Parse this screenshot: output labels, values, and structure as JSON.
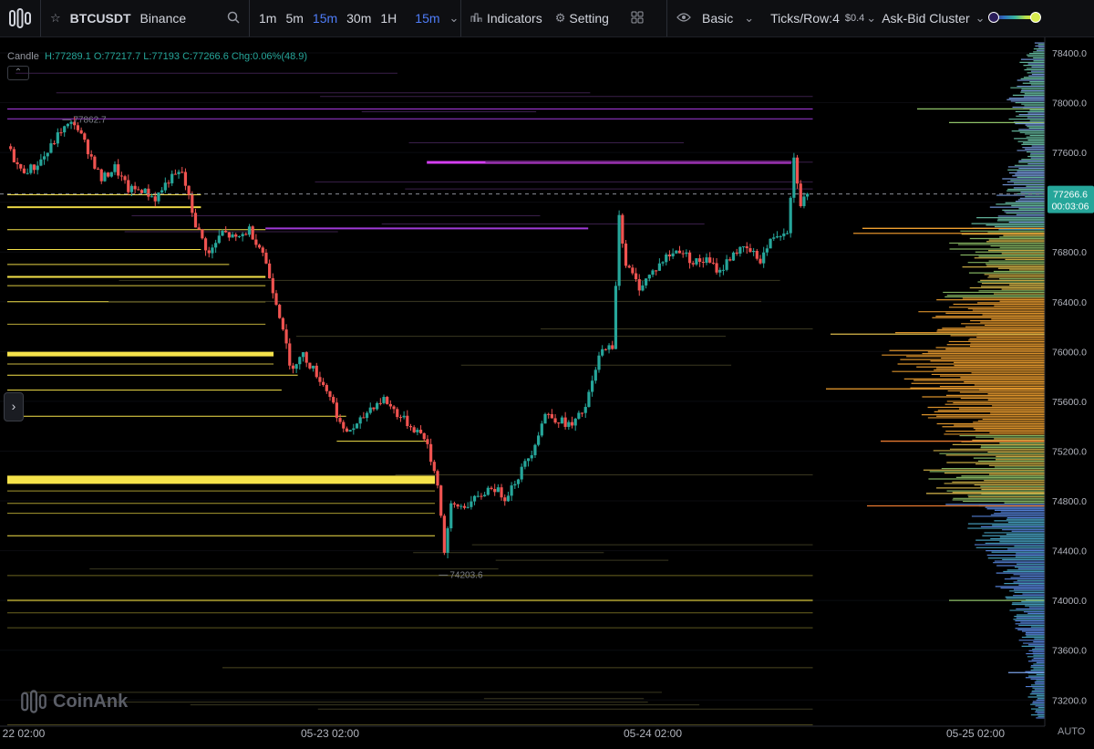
{
  "toolbar": {
    "symbol": "BTCUSDT",
    "exchange": "Binance",
    "timeframes": [
      "1m",
      "5m",
      "15m",
      "30m",
      "1H"
    ],
    "active_timeframe": "15m",
    "selected_timeframe": "15m",
    "indicators_label": "Indicators",
    "setting_label": "Setting",
    "mode_label": "Basic",
    "ticks_label": "Ticks/Row:4",
    "ticks_value": "$0.4",
    "cluster_label": "Ask-Bid Cluster"
  },
  "legend": {
    "type_label": "Candle",
    "high": "H:77289.1",
    "open": "O:77217.7",
    "low": "L:77193",
    "close": "C:77266.6",
    "change": "Chg:0.06%(48.9)",
    "collapse_glyph": "⌃"
  },
  "side_toggle": "›",
  "watermark": "CoinAnk",
  "auto_label": "AUTO",
  "colors": {
    "up": "#26a69a",
    "down": "#ef5350",
    "level_yellow": "#f5e24a",
    "level_purple": "#b43df0",
    "price_tag": "#26a69a"
  },
  "chart_data": {
    "type": "candlestick",
    "title": "",
    "price_axis": {
      "ylim": [
        73000,
        78500
      ],
      "ticks": [
        78400,
        78000,
        77600,
        77200,
        76800,
        76400,
        76000,
        75600,
        75200,
        74800,
        74400,
        74000,
        73600,
        73200
      ],
      "tick_labels": [
        "78400.0",
        "78000.0",
        "77600.0",
        "77200.0",
        "76800.0",
        "76400.0",
        "76000.0",
        "75600.0",
        "75200.0",
        "74800.0",
        "74400.0",
        "74000.0",
        "73600.0",
        "73200.0"
      ]
    },
    "time_axis": {
      "tick_labels": [
        "22 02:00",
        "05-23 02:00",
        "05-24 02:00",
        "05-25 02:00"
      ],
      "tick_hours": [
        0,
        24,
        48,
        72
      ]
    },
    "current_price": 77266.6,
    "current_price_label": "77266.6",
    "countdown": "00:03:06",
    "annotations": [
      {
        "label": "77862.7",
        "price": 77862.7,
        "hour": 4.5
      },
      {
        "label": "74203.6",
        "price": 74203.6,
        "hour": 32.5
      }
    ],
    "price_path": [
      [
        0,
        77650
      ],
      [
        1,
        77450
      ],
      [
        2,
        77480
      ],
      [
        3,
        77600
      ],
      [
        4,
        77780
      ],
      [
        5,
        77840
      ],
      [
        6,
        77620
      ],
      [
        7,
        77380
      ],
      [
        8,
        77480
      ],
      [
        9,
        77300
      ],
      [
        10,
        77300
      ],
      [
        11,
        77230
      ],
      [
        12,
        77380
      ],
      [
        13,
        77440
      ],
      [
        14,
        77020
      ],
      [
        15,
        76780
      ],
      [
        16,
        76960
      ],
      [
        17,
        76900
      ],
      [
        18,
        76980
      ],
      [
        19,
        76800
      ],
      [
        20,
        76400
      ],
      [
        20.5,
        76200
      ],
      [
        21,
        75870
      ],
      [
        22,
        75970
      ],
      [
        23,
        75820
      ],
      [
        24,
        75650
      ],
      [
        25,
        75350
      ],
      [
        26,
        75400
      ],
      [
        27,
        75550
      ],
      [
        28,
        75620
      ],
      [
        29,
        75500
      ],
      [
        30,
        75400
      ],
      [
        31,
        75320
      ],
      [
        32,
        74950
      ],
      [
        32.5,
        74400
      ],
      [
        33,
        74750
      ],
      [
        34,
        74760
      ],
      [
        35,
        74820
      ],
      [
        36,
        74920
      ],
      [
        37,
        74830
      ],
      [
        38,
        75000
      ],
      [
        39,
        75200
      ],
      [
        40,
        75500
      ],
      [
        41,
        75450
      ],
      [
        42,
        75400
      ],
      [
        43,
        75550
      ],
      [
        44,
        75950
      ],
      [
        44.5,
        76050
      ],
      [
        45,
        76000
      ],
      [
        45.5,
        77100
      ],
      [
        46,
        76700
      ],
      [
        47,
        76520
      ],
      [
        48,
        76640
      ],
      [
        49,
        76760
      ],
      [
        50,
        76820
      ],
      [
        51,
        76720
      ],
      [
        52,
        76730
      ],
      [
        53,
        76640
      ],
      [
        54,
        76800
      ],
      [
        55,
        76820
      ],
      [
        56,
        76740
      ],
      [
        57,
        76930
      ],
      [
        58,
        76980
      ],
      [
        58.5,
        77550
      ],
      [
        59,
        77200
      ],
      [
        59.6,
        77266.6
      ]
    ],
    "levels": [
      {
        "price": 77950,
        "from_hour": 0,
        "to_hour": 59.9,
        "color": "#b43df0",
        "width": 1
      },
      {
        "price": 77870,
        "from_hour": 0,
        "to_hour": 59.9,
        "color": "#a03ad8",
        "width": 1
      },
      {
        "price": 77520,
        "from_hour": 31.2,
        "to_hour": 58.3,
        "color": "#d43ef0",
        "width": 3
      },
      {
        "price": 76990,
        "from_hour": 19.2,
        "to_hour": 43.2,
        "color": "#a03ad8",
        "width": 2
      },
      {
        "price": 77260,
        "from_hour": 0,
        "to_hour": 14.4,
        "color": "#f5e24a",
        "width": 1
      },
      {
        "price": 77160,
        "from_hour": 0,
        "to_hour": 14.4,
        "color": "#e8d444",
        "width": 2
      },
      {
        "price": 76980,
        "from_hour": 0,
        "to_hour": 19.2,
        "color": "#f5e24a",
        "width": 1
      },
      {
        "price": 76820,
        "from_hour": 0,
        "to_hour": 14.4,
        "color": "#f5e24a",
        "width": 1
      },
      {
        "price": 76700,
        "from_hour": 0,
        "to_hour": 16.5,
        "color": "#e8d444",
        "width": 1
      },
      {
        "price": 76600,
        "from_hour": 0,
        "to_hour": 19.2,
        "color": "#f5e24a",
        "width": 2
      },
      {
        "price": 76530,
        "from_hour": 0,
        "to_hour": 19.2,
        "color": "#d8c640",
        "width": 1
      },
      {
        "price": 76400,
        "from_hour": 0,
        "to_hour": 19.2,
        "color": "#f5e24a",
        "width": 1
      },
      {
        "price": 76220,
        "from_hour": 0,
        "to_hour": 19.2,
        "color": "#b8a838",
        "width": 1
      },
      {
        "price": 75980,
        "from_hour": 0,
        "to_hour": 19.8,
        "color": "#f5e24a",
        "width": 5
      },
      {
        "price": 75900,
        "from_hour": 0,
        "to_hour": 19.8,
        "color": "#c8b640",
        "width": 1
      },
      {
        "price": 75810,
        "from_hour": 0,
        "to_hour": 21.6,
        "color": "#f5e24a",
        "width": 1
      },
      {
        "price": 75690,
        "from_hour": 0,
        "to_hour": 20.4,
        "color": "#f5e24a",
        "width": 1
      },
      {
        "price": 75480,
        "from_hour": 0,
        "to_hour": 25.2,
        "color": "#f5e24a",
        "width": 1
      },
      {
        "price": 75280,
        "from_hour": 24.5,
        "to_hour": 31.2,
        "color": "#f5e24a",
        "width": 1
      },
      {
        "price": 74970,
        "from_hour": 0,
        "to_hour": 31.8,
        "color": "#f5e24a",
        "width": 9
      },
      {
        "price": 74880,
        "from_hour": 0,
        "to_hour": 31.8,
        "color": "#a89a30",
        "width": 1
      },
      {
        "price": 74780,
        "from_hour": 0,
        "to_hour": 31.8,
        "color": "#a89a30",
        "width": 1
      },
      {
        "price": 74700,
        "from_hour": 0,
        "to_hour": 31.8,
        "color": "#a89a30",
        "width": 1
      },
      {
        "price": 74520,
        "from_hour": 0,
        "to_hour": 31.8,
        "color": "#f5e24a",
        "width": 1
      },
      {
        "price": 74200,
        "from_hour": 0,
        "to_hour": 59.9,
        "color": "#6d6520",
        "width": 1
      },
      {
        "price": 74000,
        "from_hour": 0,
        "to_hour": 59.9,
        "color": "#8d8228",
        "width": 2
      },
      {
        "price": 73900,
        "from_hour": 0,
        "to_hour": 59.9,
        "color": "#6d6520",
        "width": 1
      },
      {
        "price": 73780,
        "from_hour": 0,
        "to_hour": 59.9,
        "color": "#5d5620",
        "width": 1
      },
      {
        "price": 73460,
        "from_hour": 16.0,
        "to_hour": 59.9,
        "color": "#4d4820",
        "width": 1
      },
      {
        "price": 73000,
        "from_hour": 0,
        "to_hour": 59.9,
        "color": "#4d4820",
        "width": 1
      }
    ],
    "volume_profile": {
      "orientation": "horizontal",
      "peak_price": 75880,
      "bands": [
        {
          "price": 78400,
          "strength": 0.12
        },
        {
          "price": 78000,
          "strength": 0.22
        },
        {
          "price": 77600,
          "strength": 0.18
        },
        {
          "price": 77200,
          "strength": 0.28
        },
        {
          "price": 76900,
          "strength": 0.55
        },
        {
          "price": 76600,
          "strength": 0.45
        },
        {
          "price": 76300,
          "strength": 0.72
        },
        {
          "price": 76000,
          "strength": 0.95
        },
        {
          "price": 75700,
          "strength": 0.85
        },
        {
          "price": 75400,
          "strength": 0.6
        },
        {
          "price": 75100,
          "strength": 0.7
        },
        {
          "price": 74800,
          "strength": 0.55
        },
        {
          "price": 74500,
          "strength": 0.4
        },
        {
          "price": 74200,
          "strength": 0.3
        },
        {
          "price": 73900,
          "strength": 0.2
        },
        {
          "price": 73600,
          "strength": 0.12
        },
        {
          "price": 73200,
          "strength": 0.1
        }
      ]
    }
  }
}
